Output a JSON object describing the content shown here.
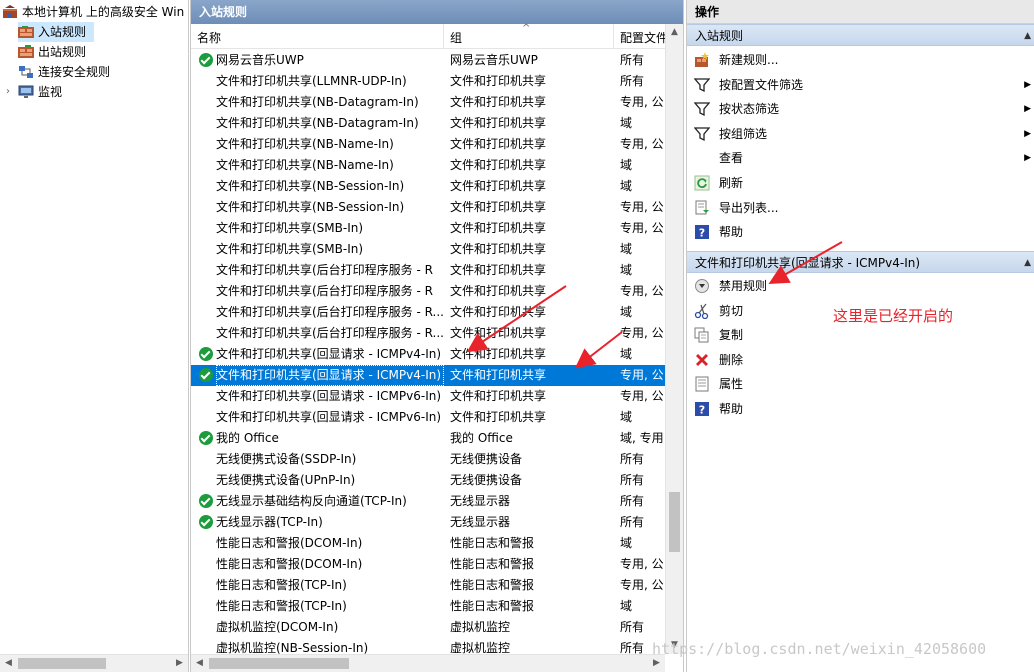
{
  "tree": {
    "root": "本地计算机 上的高级安全 Win",
    "items": [
      "入站规则",
      "出站规则",
      "连接安全规则",
      "监视"
    ]
  },
  "middle": {
    "title": "入站规则",
    "columns": [
      "名称",
      "组",
      "配置文件"
    ],
    "rows": [
      {
        "name": "网易云音乐UWP",
        "group": "网易云音乐UWP",
        "profile": "所有",
        "enabled": true
      },
      {
        "name": "文件和打印机共享(LLMNR-UDP-In)",
        "group": "文件和打印机共享",
        "profile": "所有",
        "enabled": false
      },
      {
        "name": "文件和打印机共享(NB-Datagram-In)",
        "group": "文件和打印机共享",
        "profile": "专用, 公",
        "enabled": false
      },
      {
        "name": "文件和打印机共享(NB-Datagram-In)",
        "group": "文件和打印机共享",
        "profile": "域",
        "enabled": false
      },
      {
        "name": "文件和打印机共享(NB-Name-In)",
        "group": "文件和打印机共享",
        "profile": "专用, 公",
        "enabled": false
      },
      {
        "name": "文件和打印机共享(NB-Name-In)",
        "group": "文件和打印机共享",
        "profile": "域",
        "enabled": false
      },
      {
        "name": "文件和打印机共享(NB-Session-In)",
        "group": "文件和打印机共享",
        "profile": "域",
        "enabled": false
      },
      {
        "name": "文件和打印机共享(NB-Session-In)",
        "group": "文件和打印机共享",
        "profile": "专用, 公",
        "enabled": false
      },
      {
        "name": "文件和打印机共享(SMB-In)",
        "group": "文件和打印机共享",
        "profile": "专用, 公",
        "enabled": false
      },
      {
        "name": "文件和打印机共享(SMB-In)",
        "group": "文件和打印机共享",
        "profile": "域",
        "enabled": false
      },
      {
        "name": "文件和打印机共享(后台打印程序服务 - R",
        "group": "文件和打印机共享",
        "profile": "域",
        "enabled": false
      },
      {
        "name": "文件和打印机共享(后台打印程序服务 - R",
        "group": "文件和打印机共享",
        "profile": "专用, 公",
        "enabled": false
      },
      {
        "name": "文件和打印机共享(后台打印程序服务 - R...",
        "group": "文件和打印机共享",
        "profile": "域",
        "enabled": false
      },
      {
        "name": "文件和打印机共享(后台打印程序服务 - R...",
        "group": "文件和打印机共享",
        "profile": "专用, 公",
        "enabled": false
      },
      {
        "name": "文件和打印机共享(回显请求 - ICMPv4-In)",
        "group": "文件和打印机共享",
        "profile": "域",
        "enabled": true
      },
      {
        "name": "文件和打印机共享(回显请求 - ICMPv4-In)",
        "group": "文件和打印机共享",
        "profile": "专用, 公",
        "enabled": true,
        "selected": true
      },
      {
        "name": "文件和打印机共享(回显请求 - ICMPv6-In)",
        "group": "文件和打印机共享",
        "profile": "专用, 公",
        "enabled": false
      },
      {
        "name": "文件和打印机共享(回显请求 - ICMPv6-In)",
        "group": "文件和打印机共享",
        "profile": "域",
        "enabled": false
      },
      {
        "name": "我的 Office",
        "group": "我的 Office",
        "profile": "域, 专用",
        "enabled": true
      },
      {
        "name": "无线便携式设备(SSDP-In)",
        "group": "无线便携设备",
        "profile": "所有",
        "enabled": false
      },
      {
        "name": "无线便携式设备(UPnP-In)",
        "group": "无线便携设备",
        "profile": "所有",
        "enabled": false
      },
      {
        "name": "无线显示基础结构反向通道(TCP-In)",
        "group": "无线显示器",
        "profile": "所有",
        "enabled": true
      },
      {
        "name": "无线显示器(TCP-In)",
        "group": "无线显示器",
        "profile": "所有",
        "enabled": true
      },
      {
        "name": "性能日志和警报(DCOM-In)",
        "group": "性能日志和警报",
        "profile": "域",
        "enabled": false
      },
      {
        "name": "性能日志和警报(DCOM-In)",
        "group": "性能日志和警报",
        "profile": "专用, 公",
        "enabled": false
      },
      {
        "name": "性能日志和警报(TCP-In)",
        "group": "性能日志和警报",
        "profile": "专用, 公",
        "enabled": false
      },
      {
        "name": "性能日志和警报(TCP-In)",
        "group": "性能日志和警报",
        "profile": "域",
        "enabled": false
      },
      {
        "name": "虚拟机监控(DCOM-In)",
        "group": "虚拟机监控",
        "profile": "所有",
        "enabled": false
      },
      {
        "name": "虚拟机监控(NB-Session-In)",
        "group": "虚拟机监控",
        "profile": "所有",
        "enabled": false
      }
    ]
  },
  "actions": {
    "title": "操作",
    "section1": "入站规则",
    "section1_items": [
      {
        "label": "新建规则...",
        "icon": "new-rule-icon",
        "submenu": false
      },
      {
        "label": "按配置文件筛选",
        "icon": "filter-icon",
        "submenu": true
      },
      {
        "label": "按状态筛选",
        "icon": "filter-icon",
        "submenu": true
      },
      {
        "label": "按组筛选",
        "icon": "filter-icon",
        "submenu": true
      },
      {
        "label": "查看",
        "icon": "",
        "submenu": true
      },
      {
        "label": "刷新",
        "icon": "refresh-icon",
        "submenu": false
      },
      {
        "label": "导出列表...",
        "icon": "export-icon",
        "submenu": false
      },
      {
        "label": "帮助",
        "icon": "help-icon",
        "submenu": false
      }
    ],
    "section2": "文件和打印机共享(回显请求 - ICMPv4-In)",
    "section2_items": [
      {
        "label": "禁用规则",
        "icon": "disable-icon"
      },
      {
        "label": "剪切",
        "icon": "cut-icon"
      },
      {
        "label": "复制",
        "icon": "copy-icon"
      },
      {
        "label": "删除",
        "icon": "delete-icon"
      },
      {
        "label": "属性",
        "icon": "properties-icon"
      },
      {
        "label": "帮助",
        "icon": "help-icon"
      }
    ]
  },
  "annotation": "这里是已经开启的",
  "watermark": "https://blog.csdn.net/weixin_42058600",
  "colors": {
    "selection": "#0078d7",
    "enabled": "#1c9c3c",
    "annotation": "#e8232b"
  }
}
